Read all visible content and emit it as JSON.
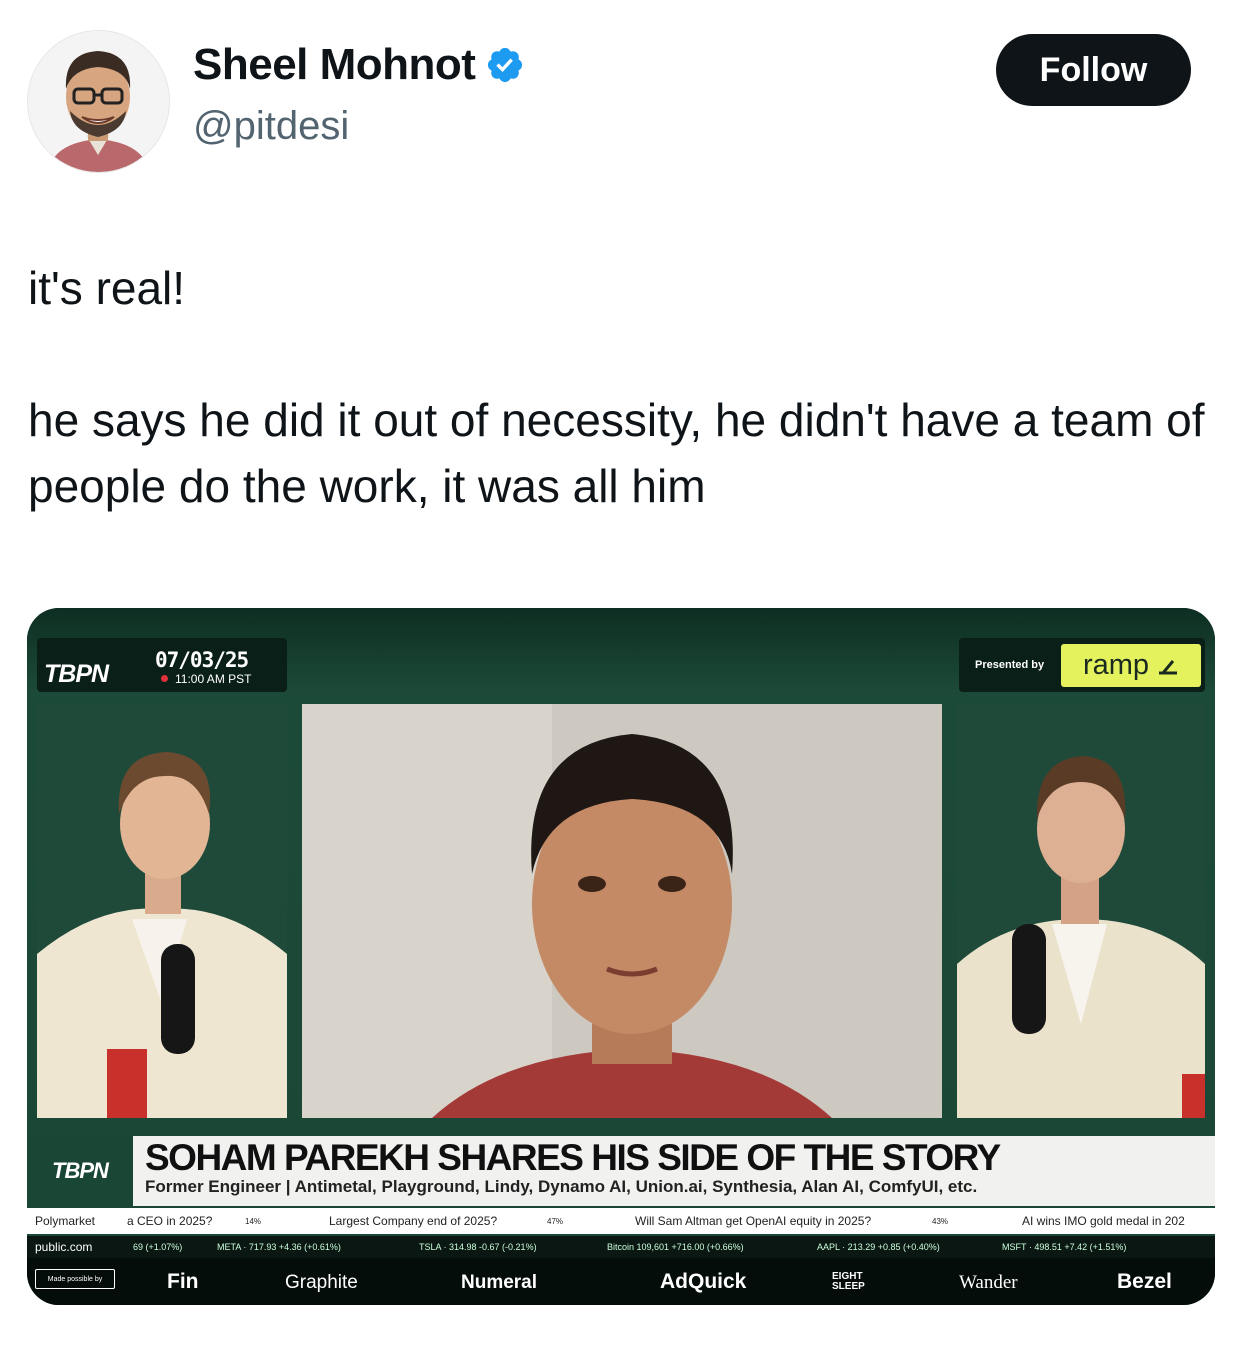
{
  "author": {
    "display_name": "Sheel Mohnot",
    "handle": "@pitdesi",
    "verified": true,
    "avatar_icon": "avatar-illustration"
  },
  "follow_label": "Follow",
  "tweet": {
    "paragraph1": "it's real!",
    "paragraph2": "he says he did it out of necessity, he didn't have a team of people do the work, it was all him"
  },
  "media": {
    "show_logo": "TBPN",
    "date": "07/03/25",
    "time": "11:00 AM PST",
    "presented_by": "Presented by",
    "sponsor_logo": "ramp",
    "lower_third_logo": "TBPN",
    "headline": "SOHAM PAREKH SHARES HIS SIDE OF THE STORY",
    "subheadline": "Former Engineer | Antimetal, Playground, Lindy, Dynamo AI, Union.ai, Synthesia, Alan AI, ComfyUI, etc.",
    "markets": [
      {
        "label": "Polymarket"
      },
      {
        "label": "a CEO in 2025?",
        "pct": "14%"
      },
      {
        "label": "Largest Company end of 2025?",
        "pct": "47%"
      },
      {
        "label": "Will Sam Altman get OpenAI equity in 2025?",
        "pct": "43%"
      },
      {
        "label": "AI wins IMO gold medal in 202"
      }
    ],
    "stocks_provider": "public.com",
    "stocks": [
      {
        "text": "69 (+1.07%)"
      },
      {
        "text": "META · 717.93 +4.36 (+0.61%)"
      },
      {
        "text": "TSLA · 314.98 -0.67 (-0.21%)"
      },
      {
        "text": "Bitcoin 109,601 +716.00 (+0.66%)"
      },
      {
        "text": "AAPL · 213.29 +0.85 (+0.40%)"
      },
      {
        "text": "MSFT · 498.51 +7.42 (+1.51%)"
      }
    ],
    "made_possible_by": "Made possible by",
    "sponsors": [
      "Fin",
      "Graphite",
      "Numeral",
      "AdQuick",
      "EIGHT SLEEP",
      "Wander",
      "Bezel"
    ]
  },
  "colors": {
    "verified_blue": "#1d9bf0",
    "follow_bg": "#0f1419",
    "ramp_yellow": "#e4f25d",
    "studio_green": "#1a4636"
  }
}
